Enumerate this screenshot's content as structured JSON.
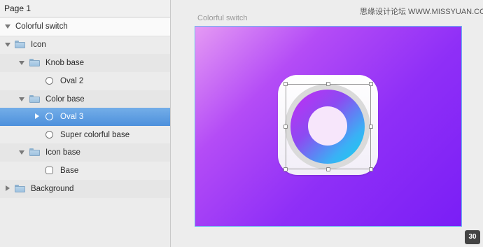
{
  "page": {
    "title": "Page 1"
  },
  "layers": [
    {
      "label": "Colorful switch",
      "icon": "artboard-expand-icon",
      "kind": "artboard"
    },
    {
      "label": "Icon",
      "icon": "folder-icon",
      "kind": "group"
    },
    {
      "label": "Knob base",
      "icon": "folder-icon",
      "kind": "group"
    },
    {
      "label": "Oval 2",
      "icon": "oval-icon",
      "kind": "shape"
    },
    {
      "label": "Color base",
      "icon": "folder-icon",
      "kind": "group"
    },
    {
      "label": "Oval 3",
      "icon": "oval-icon",
      "kind": "shape",
      "selected": true
    },
    {
      "label": "Super colorful base",
      "icon": "oval-icon",
      "kind": "shape"
    },
    {
      "label": "Icon base",
      "icon": "folder-icon",
      "kind": "group"
    },
    {
      "label": "Base",
      "icon": "rounded-rect-icon",
      "kind": "shape"
    },
    {
      "label": "Background",
      "icon": "folder-icon",
      "kind": "group"
    }
  ],
  "canvas": {
    "artboard_title": "Colorful switch",
    "zoom_badge": "30",
    "colors": {
      "selection": "#4d90dc",
      "artboard_border": "#6cb6f0",
      "gradient_start": "#e59af4",
      "gradient_end": "#7a1ef6",
      "ring_start": "#c42cf4",
      "ring_end": "#13d4ee"
    }
  },
  "watermark": "思缘设计论坛 WWW.MISSYUAN.COM"
}
